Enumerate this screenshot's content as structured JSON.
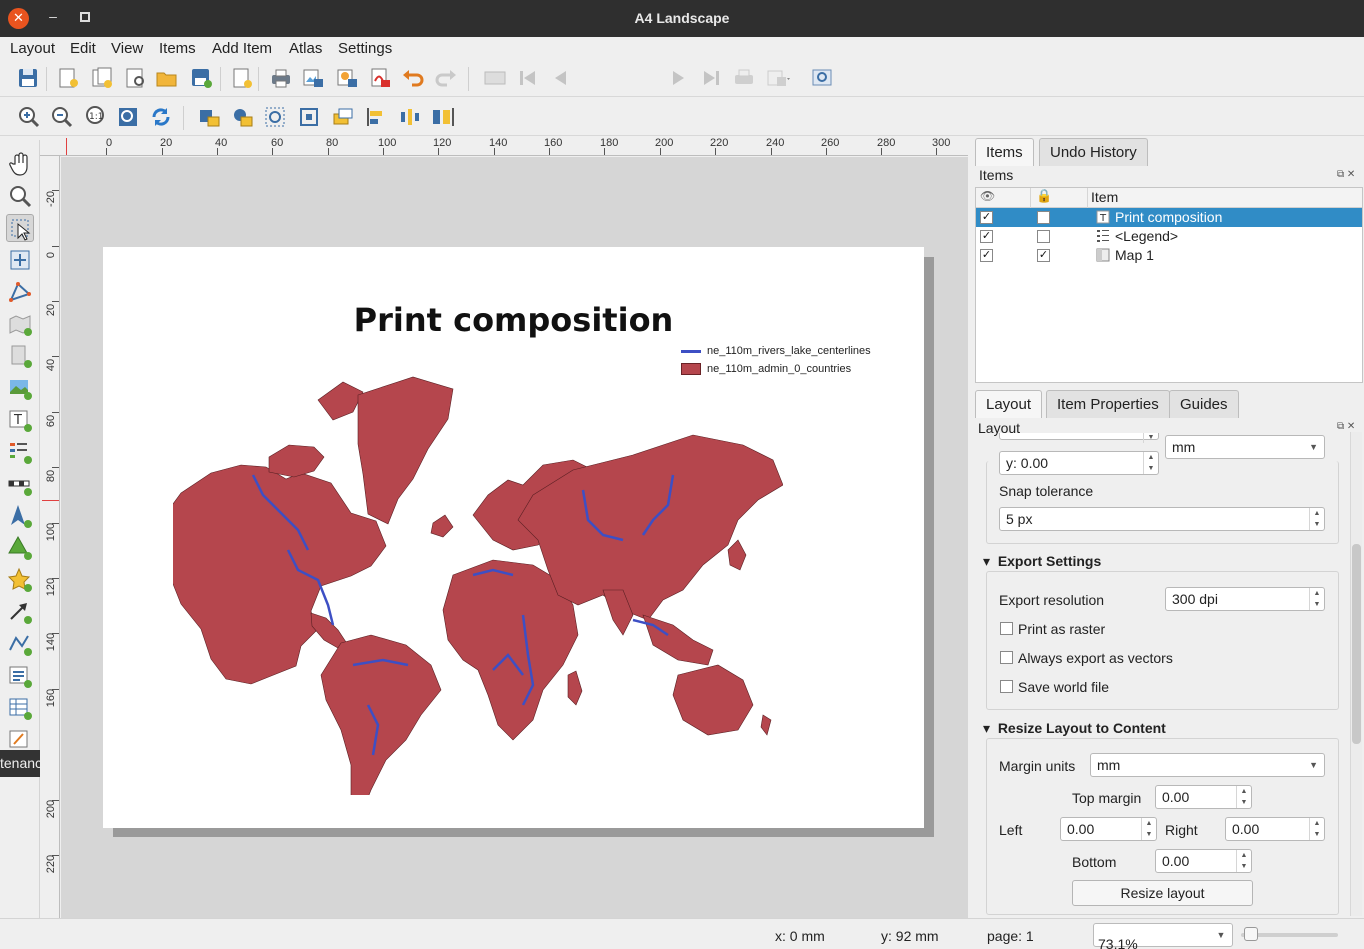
{
  "window": {
    "title": "A4 Landscape"
  },
  "menu": [
    "Layout",
    "Edit",
    "View",
    "Items",
    "Add Item",
    "Atlas",
    "Settings"
  ],
  "toolbar": {
    "page_number": "1"
  },
  "tooltip": "tenance",
  "ruler": {
    "top": [
      "0",
      "20",
      "40",
      "60",
      "80",
      "100",
      "120",
      "140",
      "160",
      "180",
      "200",
      "220",
      "240",
      "260",
      "280",
      "300"
    ],
    "left": [
      "-20",
      "0",
      "20",
      "40",
      "60",
      "80",
      "100",
      "120",
      "140",
      "160",
      "180",
      "200",
      "220"
    ]
  },
  "composition": {
    "title": "Print composition",
    "legend": [
      {
        "label": "ne_110m_rivers_lake_centerlines",
        "type": "line",
        "color": "#3d4fc4"
      },
      {
        "label": "ne_110m_admin_0_countries",
        "type": "fill",
        "color": "#b5464d"
      }
    ]
  },
  "right_panel": {
    "top_tabs": [
      "Items",
      "Undo History"
    ],
    "items_title": "Items",
    "tree_header": "Item",
    "items": [
      {
        "label": "Print composition",
        "visible": true,
        "locked": false,
        "selected": true,
        "icon": "text-label-icon"
      },
      {
        "label": "<Legend>",
        "visible": true,
        "locked": false,
        "selected": false,
        "icon": "legend-icon"
      },
      {
        "label": "Map 1",
        "visible": true,
        "locked": true,
        "selected": false,
        "icon": "map-icon"
      }
    ],
    "bottom_tabs": [
      "Layout",
      "Item Properties",
      "Guides"
    ],
    "layout_title": "Layout",
    "grid": {
      "y_value": "y: 0.00",
      "units": "mm"
    },
    "snap_tolerance_label": "Snap tolerance",
    "snap_tolerance_value": "5 px",
    "export_settings": {
      "title": "Export Settings",
      "resolution_label": "Export resolution",
      "resolution_value": "300 dpi",
      "print_as_raster": "Print as raster",
      "always_vectors": "Always export as vectors",
      "save_world_file": "Save world file"
    },
    "resize": {
      "title": "Resize Layout to Content",
      "margin_units_label": "Margin units",
      "margin_units_value": "mm",
      "top_label": "Top margin",
      "top_value": "0.00",
      "left_label": "Left",
      "left_value": "0.00",
      "right_label": "Right",
      "right_value": "0.00",
      "bottom_label": "Bottom",
      "bottom_value": "0.00",
      "button": "Resize layout"
    }
  },
  "status": {
    "x": "x: 0 mm",
    "y": "y: 92 mm",
    "page": "page: 1",
    "zoom": "73.1%"
  }
}
